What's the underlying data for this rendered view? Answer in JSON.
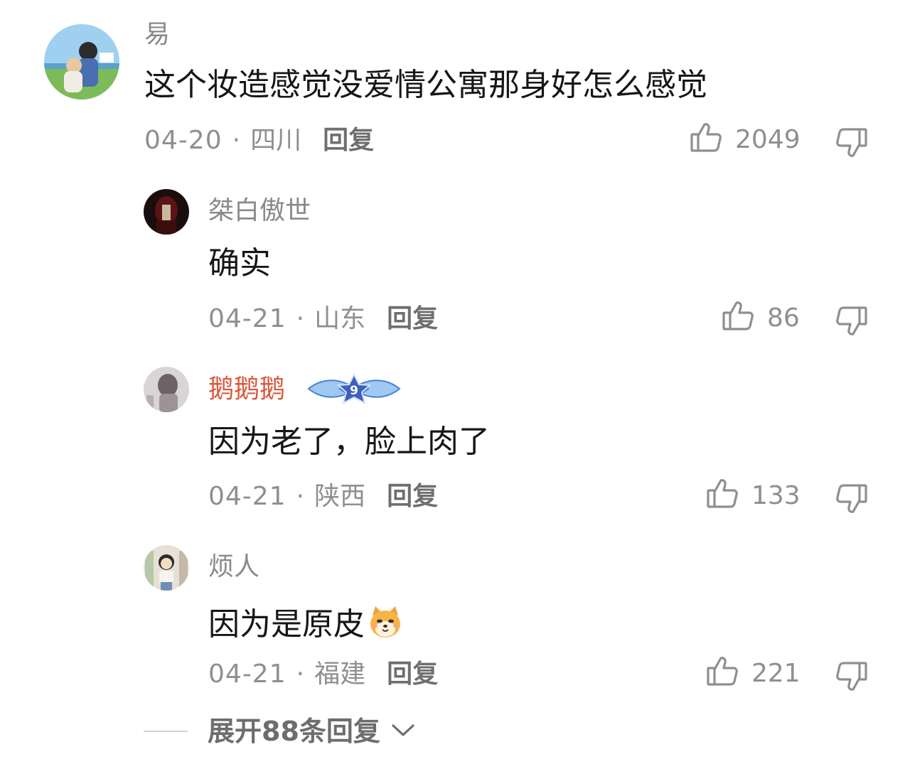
{
  "comments": [
    {
      "username": "易",
      "content": "这个妆造感觉没爱情公寓那身好怎么感觉",
      "date": "04-20",
      "separator": "·",
      "location": "四川",
      "reply_label": "回复",
      "likes": "2049"
    },
    {
      "username": "桀白傲世",
      "content": "确实",
      "date": "04-21",
      "separator": "·",
      "location": "山东",
      "reply_label": "回复",
      "likes": "86"
    },
    {
      "username": "鹅鹅鹅",
      "badge_level": "9",
      "content": "因为老了，脸上肉了",
      "date": "04-21",
      "separator": "·",
      "location": "陕西",
      "reply_label": "回复",
      "likes": "133"
    },
    {
      "username": "烦人",
      "content": "因为是原皮",
      "date": "04-21",
      "separator": "·",
      "location": "福建",
      "reply_label": "回复",
      "likes": "221"
    }
  ],
  "expand": {
    "label": "展开88条回复"
  },
  "icons": {
    "like": "thumbs-up-icon",
    "dislike": "thumbs-down-icon",
    "expand": "chevron-down-icon",
    "emoji": "shiba-dog-emoji-icon"
  },
  "colors": {
    "username": "#8a8a8a",
    "vip_username": "#d9573a",
    "meta": "#8f8f8f",
    "content": "#161616"
  }
}
